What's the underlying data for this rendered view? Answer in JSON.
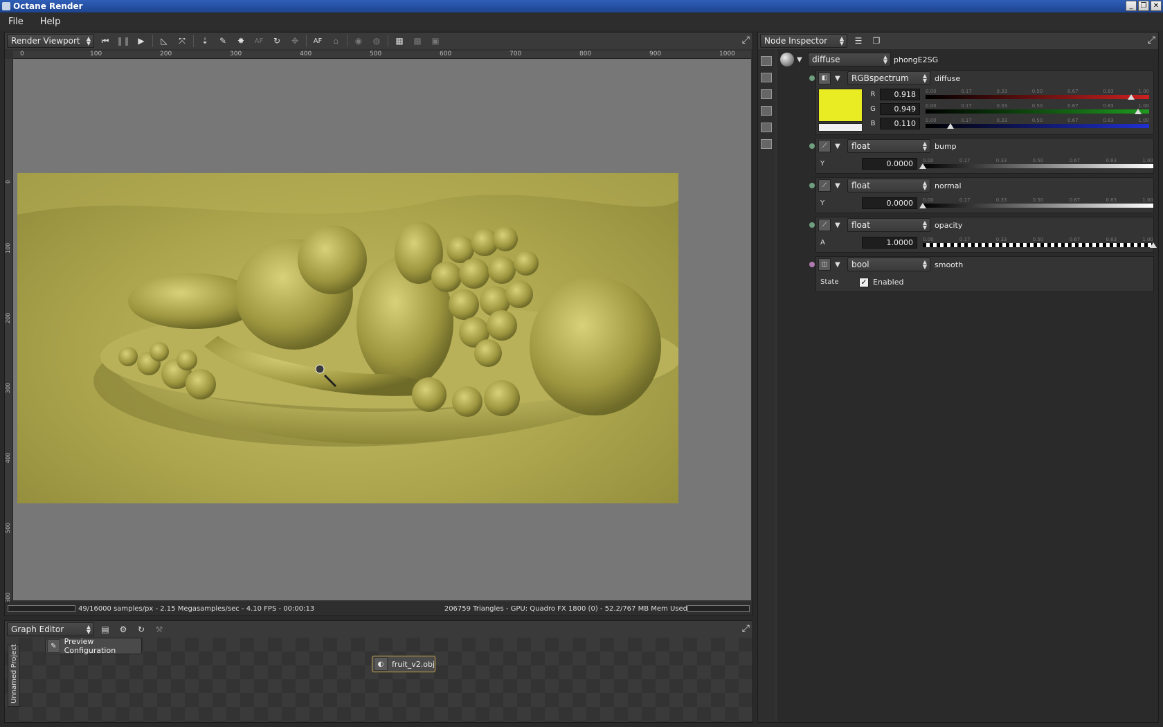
{
  "window": {
    "title": "Octane Render",
    "controls": [
      "_",
      "❐",
      "✕"
    ]
  },
  "menu": [
    "File",
    "Help"
  ],
  "viewport": {
    "selector": "Render Viewport",
    "ruler_h": [
      "0",
      "100",
      "200",
      "300",
      "400",
      "500",
      "600",
      "700",
      "800",
      "900",
      "1000"
    ],
    "ruler_v": [
      "0",
      "100",
      "200",
      "300",
      "400",
      "500",
      "600"
    ],
    "toolbar": {
      "af_label": "AF",
      "af2_label": "AF"
    },
    "status_left": "49/16000 samples/px - 2.15 Megasamples/sec - 4.10 FPS - 00:00:13",
    "status_right": "206759 Triangles - GPU: Quadro FX 1800 (0) - 52.2/767 MB Mem Used"
  },
  "graph_editor": {
    "selector": "Graph Editor",
    "side_tab": "Unnamed Project",
    "nodes": [
      {
        "label": "Preview Configuration"
      },
      {
        "label": "fruit_v2.obj"
      }
    ]
  },
  "inspector": {
    "selector": "Node Inspector",
    "root": {
      "type": "diffuse",
      "name": "phongE2SG"
    },
    "pins": [
      {
        "type": "RGBspectrum",
        "name": "diffuse",
        "color": "#e9ec22",
        "scale": [
          "0.00",
          "0.17",
          "0.33",
          "0.50",
          "0.67",
          "0.83",
          "1.00"
        ],
        "channels": [
          {
            "label": "R",
            "value": "0.918",
            "fraction": 0.918,
            "color": "#cc2020"
          },
          {
            "label": "G",
            "value": "0.949",
            "fraction": 0.949,
            "color": "#1e9a1e"
          },
          {
            "label": "B",
            "value": "0.110",
            "fraction": 0.11,
            "color": "#2030d0"
          }
        ]
      },
      {
        "type": "float",
        "name": "bump",
        "param_label": "Y",
        "value": "0.0000",
        "fraction": 0.0,
        "scale": [
          "0.00",
          "0.17",
          "0.33",
          "0.50",
          "0.67",
          "0.83",
          "1.00"
        ]
      },
      {
        "type": "float",
        "name": "normal",
        "param_label": "Y",
        "value": "0.0000",
        "fraction": 0.0,
        "scale": [
          "0.00",
          "0.17",
          "0.33",
          "0.50",
          "0.67",
          "0.83",
          "1.00"
        ]
      },
      {
        "type": "float",
        "name": "opacity",
        "param_label": "A",
        "value": "1.0000",
        "fraction": 1.0,
        "scale": [
          "0.00",
          "0.17",
          "0.33",
          "0.50",
          "0.67",
          "0.83",
          "1.00"
        ]
      },
      {
        "type": "bool",
        "name": "smooth",
        "param_label": "State",
        "checkbox_label": "Enabled",
        "checked": true
      }
    ]
  }
}
